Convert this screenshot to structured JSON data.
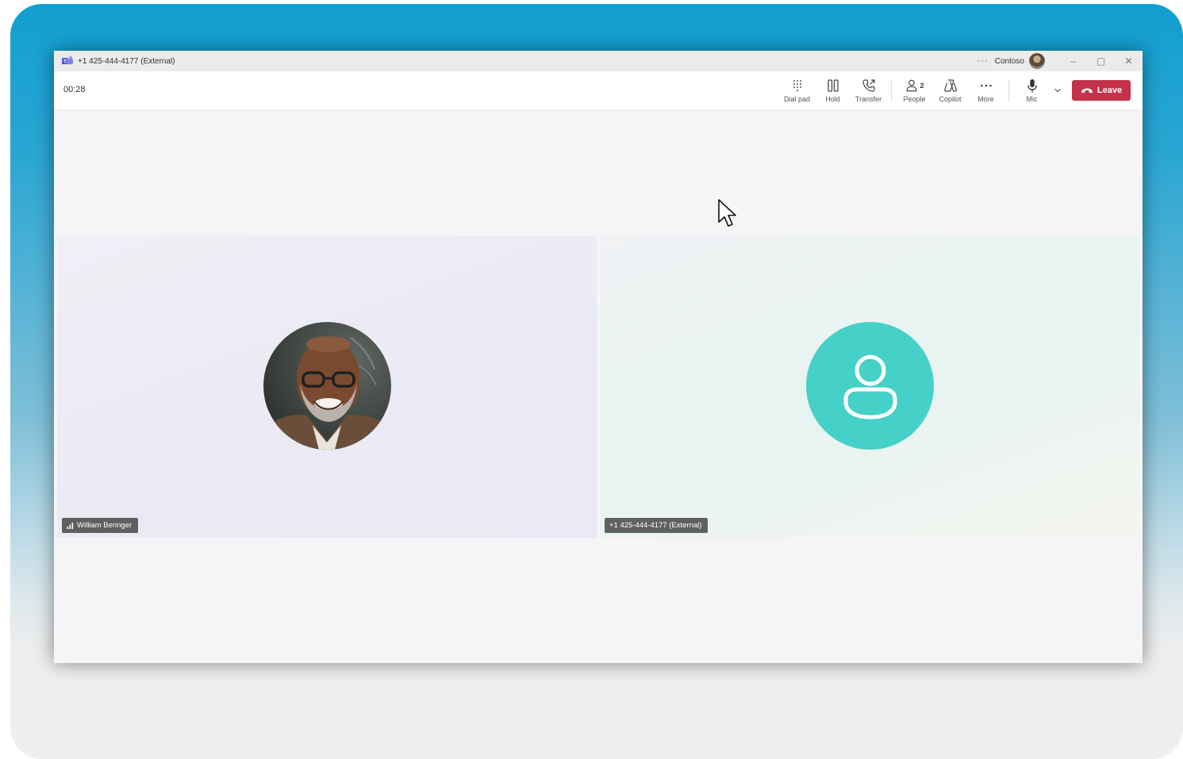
{
  "window": {
    "title": "+1 425-444-4177 (External)",
    "org_name": "Contoso",
    "more_glyph": "···",
    "minimize_glyph": "–",
    "restore_glyph": "▢",
    "close_glyph": "✕"
  },
  "toolbar": {
    "timer": "00:28",
    "dialpad_label": "Dial pad",
    "hold_label": "Hold",
    "transfer_label": "Transfer",
    "people_label": "People",
    "people_count": "2",
    "copilot_label": "Copilot",
    "more_label": "More",
    "mic_label": "Mic",
    "leave_label": "Leave"
  },
  "participants": [
    {
      "name": "William Beringer",
      "avatar": "photo"
    },
    {
      "name": "+1 425-444-4177 (External)",
      "avatar": "person-icon"
    }
  ],
  "colors": {
    "leave": "#c4314b",
    "generic_avatar": "#45d1c7",
    "frame_top": "#119fd0"
  }
}
